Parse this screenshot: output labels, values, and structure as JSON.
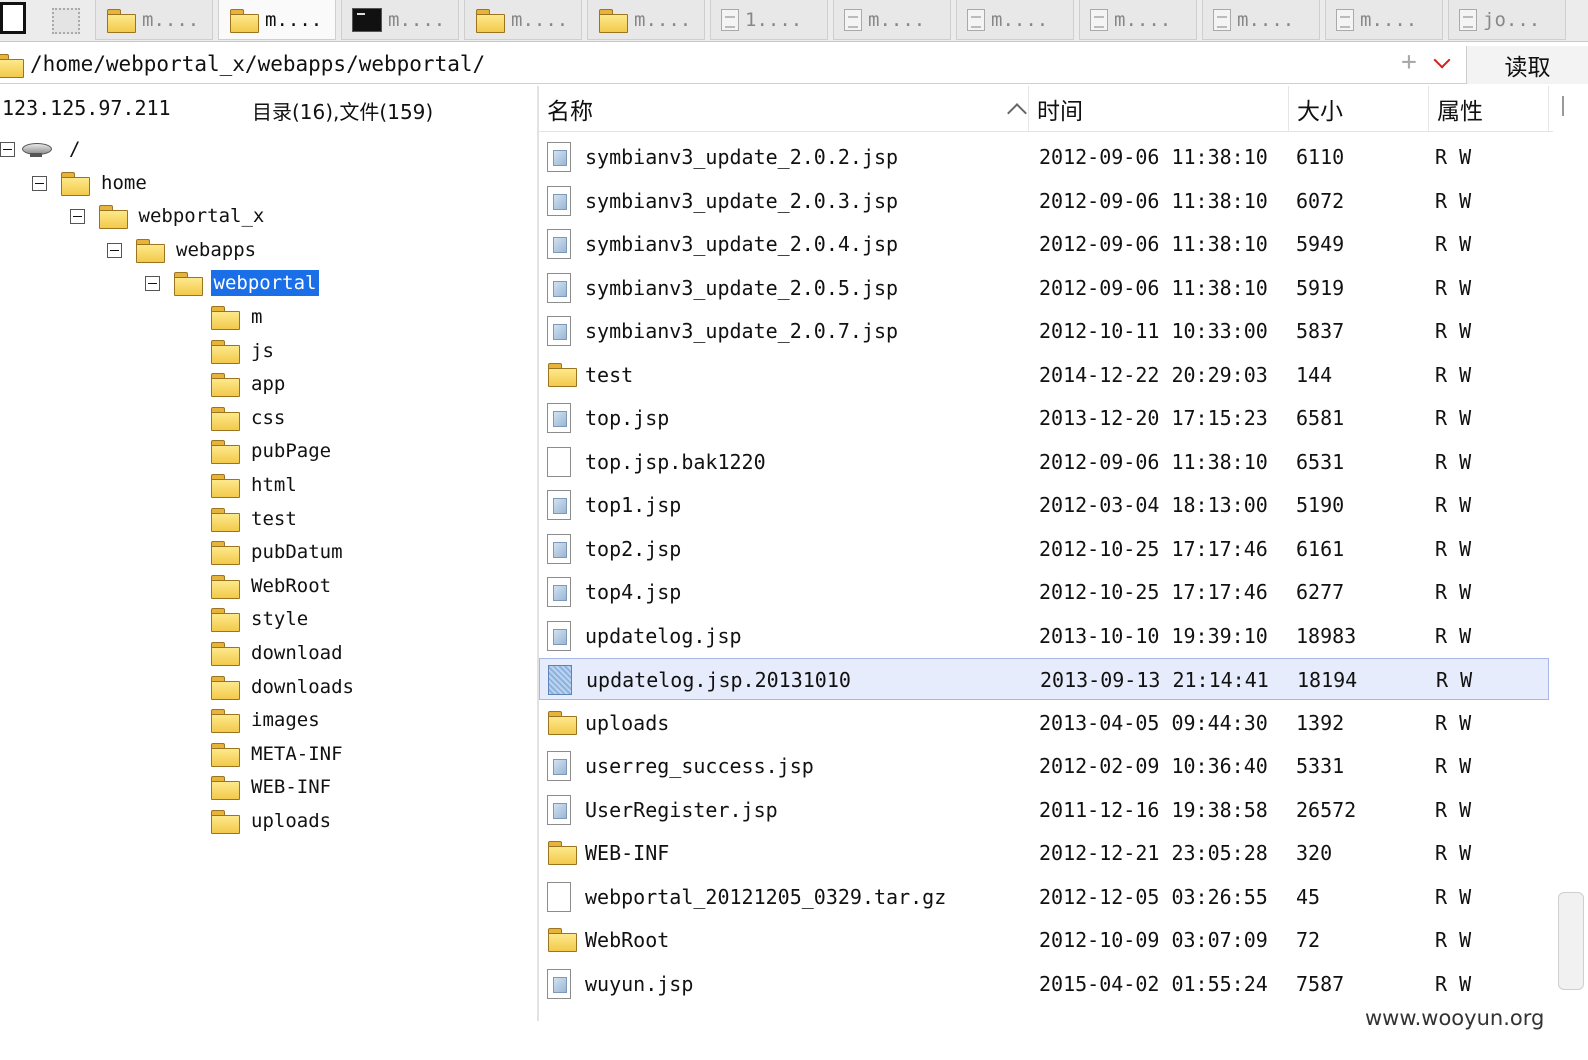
{
  "tabs": [
    {
      "label": "",
      "icon": "terminal-selected-icon",
      "active": false
    },
    {
      "label": "",
      "icon": "selection-icon",
      "active": false
    },
    {
      "label": "m....",
      "icon": "folder-icon",
      "active": false
    },
    {
      "label": "m....",
      "icon": "folder-icon",
      "active": true
    },
    {
      "label": "m....",
      "icon": "terminal-icon",
      "active": false
    },
    {
      "label": "m....",
      "icon": "folder-icon",
      "active": false
    },
    {
      "label": "m....",
      "icon": "folder-icon",
      "active": false
    },
    {
      "label": "1....",
      "icon": "document-icon",
      "active": false
    },
    {
      "label": "m....",
      "icon": "document-icon",
      "active": false
    },
    {
      "label": "m....",
      "icon": "document-icon",
      "active": false
    },
    {
      "label": "m....",
      "icon": "document-icon",
      "active": false
    },
    {
      "label": "m....",
      "icon": "document-icon",
      "active": false
    },
    {
      "label": "m....",
      "icon": "document-icon",
      "active": false
    },
    {
      "label": "jo...",
      "icon": "document-icon",
      "active": false
    }
  ],
  "pathbar": {
    "path": "/home/webportal_x/webapps/webportal/",
    "add_symbol": "+",
    "read_button": "读取"
  },
  "left_pane": {
    "ip": "123.125.97.211",
    "counts": "目录(16),文件(159)"
  },
  "tree": [
    {
      "label": "/",
      "depth": 0,
      "type": "drive",
      "expanded": true
    },
    {
      "label": "home",
      "depth": 1,
      "type": "folder",
      "expanded": true
    },
    {
      "label": "webportal_x",
      "depth": 2,
      "type": "folder",
      "expanded": true
    },
    {
      "label": "webapps",
      "depth": 3,
      "type": "folder",
      "expanded": true
    },
    {
      "label": "webportal",
      "depth": 4,
      "type": "folder",
      "expanded": true,
      "selected": true
    },
    {
      "label": "m",
      "depth": 5,
      "type": "folder"
    },
    {
      "label": "js",
      "depth": 5,
      "type": "folder"
    },
    {
      "label": "app",
      "depth": 5,
      "type": "folder"
    },
    {
      "label": "css",
      "depth": 5,
      "type": "folder"
    },
    {
      "label": "pubPage",
      "depth": 5,
      "type": "folder"
    },
    {
      "label": "html",
      "depth": 5,
      "type": "folder"
    },
    {
      "label": "test",
      "depth": 5,
      "type": "folder"
    },
    {
      "label": "pubDatum",
      "depth": 5,
      "type": "folder"
    },
    {
      "label": "WebRoot",
      "depth": 5,
      "type": "folder"
    },
    {
      "label": "style",
      "depth": 5,
      "type": "folder"
    },
    {
      "label": "download",
      "depth": 5,
      "type": "folder"
    },
    {
      "label": "downloads",
      "depth": 5,
      "type": "folder"
    },
    {
      "label": "images",
      "depth": 5,
      "type": "folder"
    },
    {
      "label": "META-INF",
      "depth": 5,
      "type": "folder"
    },
    {
      "label": "WEB-INF",
      "depth": 5,
      "type": "folder"
    },
    {
      "label": "uploads",
      "depth": 5,
      "type": "folder"
    }
  ],
  "columns": {
    "name": "名称",
    "time": "时间",
    "size": "大小",
    "attr": "属性"
  },
  "files": [
    {
      "name": "symbianv3_update_2.0.2.jsp",
      "time": "2012-09-06 11:38:10",
      "size": "6110",
      "attr": "R W",
      "type": "jsp"
    },
    {
      "name": "symbianv3_update_2.0.3.jsp",
      "time": "2012-09-06 11:38:10",
      "size": "6072",
      "attr": "R W",
      "type": "jsp"
    },
    {
      "name": "symbianv3_update_2.0.4.jsp",
      "time": "2012-09-06 11:38:10",
      "size": "5949",
      "attr": "R W",
      "type": "jsp"
    },
    {
      "name": "symbianv3_update_2.0.5.jsp",
      "time": "2012-09-06 11:38:10",
      "size": "5919",
      "attr": "R W",
      "type": "jsp"
    },
    {
      "name": "symbianv3_update_2.0.7.jsp",
      "time": "2012-10-11 10:33:00",
      "size": "5837",
      "attr": "R W",
      "type": "jsp"
    },
    {
      "name": "test",
      "time": "2014-12-22 20:29:03",
      "size": "144",
      "attr": "R W",
      "type": "folder"
    },
    {
      "name": "top.jsp",
      "time": "2013-12-20 17:15:23",
      "size": "6581",
      "attr": "R W",
      "type": "jsp"
    },
    {
      "name": "top.jsp.bak1220",
      "time": "2012-09-06 11:38:10",
      "size": "6531",
      "attr": "R W",
      "type": "plain"
    },
    {
      "name": "top1.jsp",
      "time": "2012-03-04 18:13:00",
      "size": "5190",
      "attr": "R W",
      "type": "jsp"
    },
    {
      "name": "top2.jsp",
      "time": "2012-10-25 17:17:46",
      "size": "6161",
      "attr": "R W",
      "type": "jsp"
    },
    {
      "name": "top4.jsp",
      "time": "2012-10-25 17:17:46",
      "size": "6277",
      "attr": "R W",
      "type": "jsp"
    },
    {
      "name": "updatelog.jsp",
      "time": "2013-10-10 19:39:10",
      "size": "18983",
      "attr": "R W",
      "type": "jsp"
    },
    {
      "name": "updatelog.jsp.20131010",
      "time": "2013-09-13 21:14:41",
      "size": "18194",
      "attr": "R W",
      "type": "blue",
      "selected": true
    },
    {
      "name": "uploads",
      "time": "2013-04-05 09:44:30",
      "size": "1392",
      "attr": "R W",
      "type": "folder"
    },
    {
      "name": "userreg_success.jsp",
      "time": "2012-02-09 10:36:40",
      "size": "5331",
      "attr": "R W",
      "type": "jsp"
    },
    {
      "name": "UserRegister.jsp",
      "time": "2011-12-16 19:38:58",
      "size": "26572",
      "attr": "R W",
      "type": "jsp"
    },
    {
      "name": "WEB-INF",
      "time": "2012-12-21 23:05:28",
      "size": "320",
      "attr": "R W",
      "type": "folder"
    },
    {
      "name": "webportal_20121205_0329.tar.gz",
      "time": "2012-12-05 03:26:55",
      "size": "45",
      "attr": "R W",
      "type": "plain"
    },
    {
      "name": "WebRoot",
      "time": "2012-10-09 03:07:09",
      "size": "72",
      "attr": "R W",
      "type": "folder"
    },
    {
      "name": "wuyun.jsp",
      "time": "2015-04-02 01:55:24",
      "size": "7587",
      "attr": "R W",
      "type": "jsp"
    }
  ],
  "watermark": "www.wooyun.org",
  "colors": {
    "selection_blue": "#1a6ee8",
    "row_highlight": "#e6ecfb",
    "folder_yellow": "#f2c94c",
    "chevron_red": "#d02020"
  }
}
